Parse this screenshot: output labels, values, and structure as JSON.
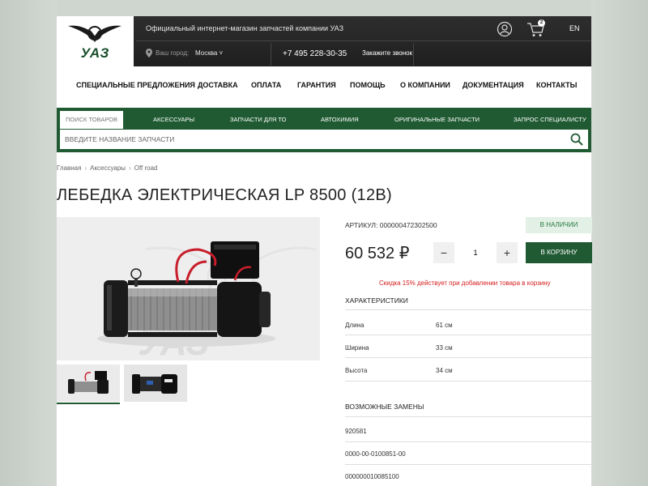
{
  "header": {
    "logo_text": "УАЗ",
    "tagline": "Официальный интернет-магазин запчастей компании УАЗ",
    "city_label": "Ваш город:",
    "city_value": "Москва",
    "phone": "+7 495 228-30-35",
    "callback": "Закажите звонок",
    "cart_count": "2",
    "lang": "EN"
  },
  "main_nav": [
    "СПЕЦИАЛЬНЫЕ ПРЕДЛОЖЕНИЯ",
    "ДОСТАВКА",
    "ОПЛАТА",
    "ГАРАНТИЯ",
    "ПОМОЩЬ",
    "О КОМПАНИИ",
    "ДОКУМЕНТАЦИЯ",
    "КОНТАКТЫ"
  ],
  "catalog": {
    "search_tab": "ПОИСК ТОВАРОВ",
    "items": [
      "АКСЕССУАРЫ",
      "ЗАПЧАСТИ ДЛЯ ТО",
      "АВТОХИМИЯ",
      "ОРИГИНАЛЬНЫЕ ЗАПЧАСТИ",
      "ЗАПРОС СПЕЦИАЛИСТУ"
    ],
    "search_placeholder": "ВВЕДИТЕ НАЗВАНИЕ ЗАПЧАСТИ"
  },
  "breadcrumb": [
    "Главная",
    "Аксессуары",
    "Off road"
  ],
  "product": {
    "title": "ЛЕБЕДКА ЭЛЕКТРИЧЕСКАЯ LP 8500 (12В)",
    "sku": "АРТИКУЛ: 000000472302500",
    "stock": "В НАЛИЧИИ",
    "price": "60 532 ₽",
    "quantity": "1",
    "add_to_cart": "В КОРЗИНУ",
    "discount_note": "Скидка 15% действует при добавлении товара в корзину"
  },
  "specs": {
    "heading": "ХАРАКТЕРИСТИКИ",
    "rows": [
      {
        "name": "Длина",
        "value": "61 см"
      },
      {
        "name": "Ширина",
        "value": "33 см"
      },
      {
        "name": "Высота",
        "value": "34 см"
      }
    ]
  },
  "replacements": {
    "heading": "ВОЗМОЖНЫЕ ЗАМЕНЫ",
    "items": [
      "920581",
      "0000-00-0100851-00",
      "000000010085100"
    ]
  },
  "colors": {
    "brand_green": "#1f5a32",
    "stock_bg": "#e2f0e5",
    "discount_red": "#d62020"
  }
}
